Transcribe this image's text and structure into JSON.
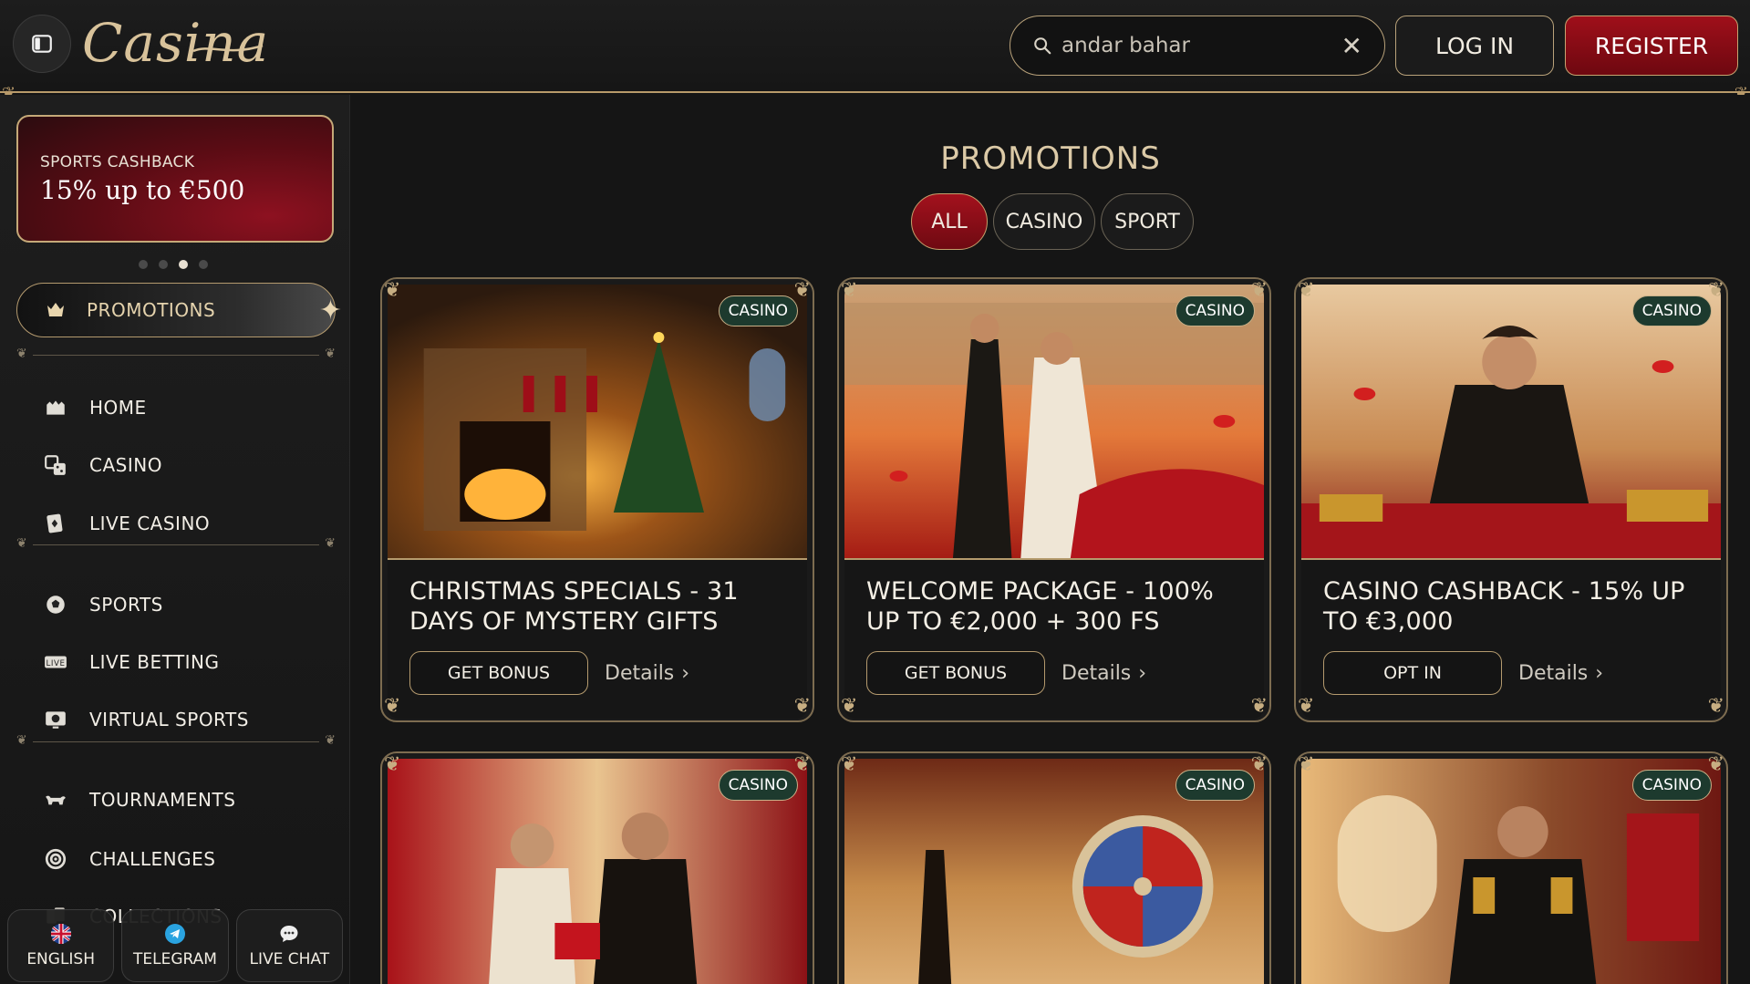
{
  "header": {
    "logo_text": "Casina",
    "search": {
      "value": "andar bahar",
      "placeholder": ""
    },
    "login_label": "LOG IN",
    "register_label": "REGISTER"
  },
  "sidebar": {
    "banner": {
      "title": "SPORTS CASHBACK",
      "value": "15% up to €500"
    },
    "carousel": {
      "count": 4,
      "active": 3
    },
    "promotions_label": "PROMOTIONS",
    "items": [
      {
        "label": "HOME",
        "icon": "home-icon"
      },
      {
        "label": "CASINO",
        "icon": "dice-icon"
      },
      {
        "label": "LIVE CASINO",
        "icon": "live-casino-icon"
      },
      {
        "label": "SPORTS",
        "icon": "soccer-ball-icon"
      },
      {
        "label": "LIVE BETTING",
        "icon": "live-icon"
      },
      {
        "label": "VIRTUAL SPORTS",
        "icon": "virtual-sports-icon"
      },
      {
        "label": "TOURNAMENTS",
        "icon": "bull-icon"
      },
      {
        "label": "CHALLENGES",
        "icon": "target-icon"
      },
      {
        "label": "COLLECTIONS",
        "icon": "cards-icon"
      }
    ],
    "bottom": [
      {
        "label": "ENGLISH",
        "icon": "uk-flag-icon"
      },
      {
        "label": "TELEGRAM",
        "icon": "telegram-icon"
      },
      {
        "label": "LIVE CHAT",
        "icon": "chat-icon"
      }
    ]
  },
  "main": {
    "title": "PROMOTIONS",
    "filters": [
      "ALL",
      "CASINO",
      "SPORT"
    ],
    "active_filter": "ALL",
    "cards": [
      {
        "tag": "CASINO",
        "title": "CHRISTMAS SPECIALS - 31 DAYS OF MYSTERY GIFTS",
        "cta": "GET BONUS",
        "details": "Details"
      },
      {
        "tag": "CASINO",
        "title": "WELCOME PACKAGE - 100% UP TO €2,000 + 300 FS",
        "cta": "GET BONUS",
        "details": "Details"
      },
      {
        "tag": "CASINO",
        "title": "CASINO CASHBACK - 15% UP TO €3,000",
        "cta": "OPT IN",
        "details": "Details"
      },
      {
        "tag": "CASINO"
      },
      {
        "tag": "CASINO"
      },
      {
        "tag": "CASINO"
      }
    ]
  },
  "colors": {
    "accent_red": "#9f0f1a",
    "gold": "#c7ae82",
    "tag_green": "#1d3a2e",
    "background": "#141414"
  }
}
